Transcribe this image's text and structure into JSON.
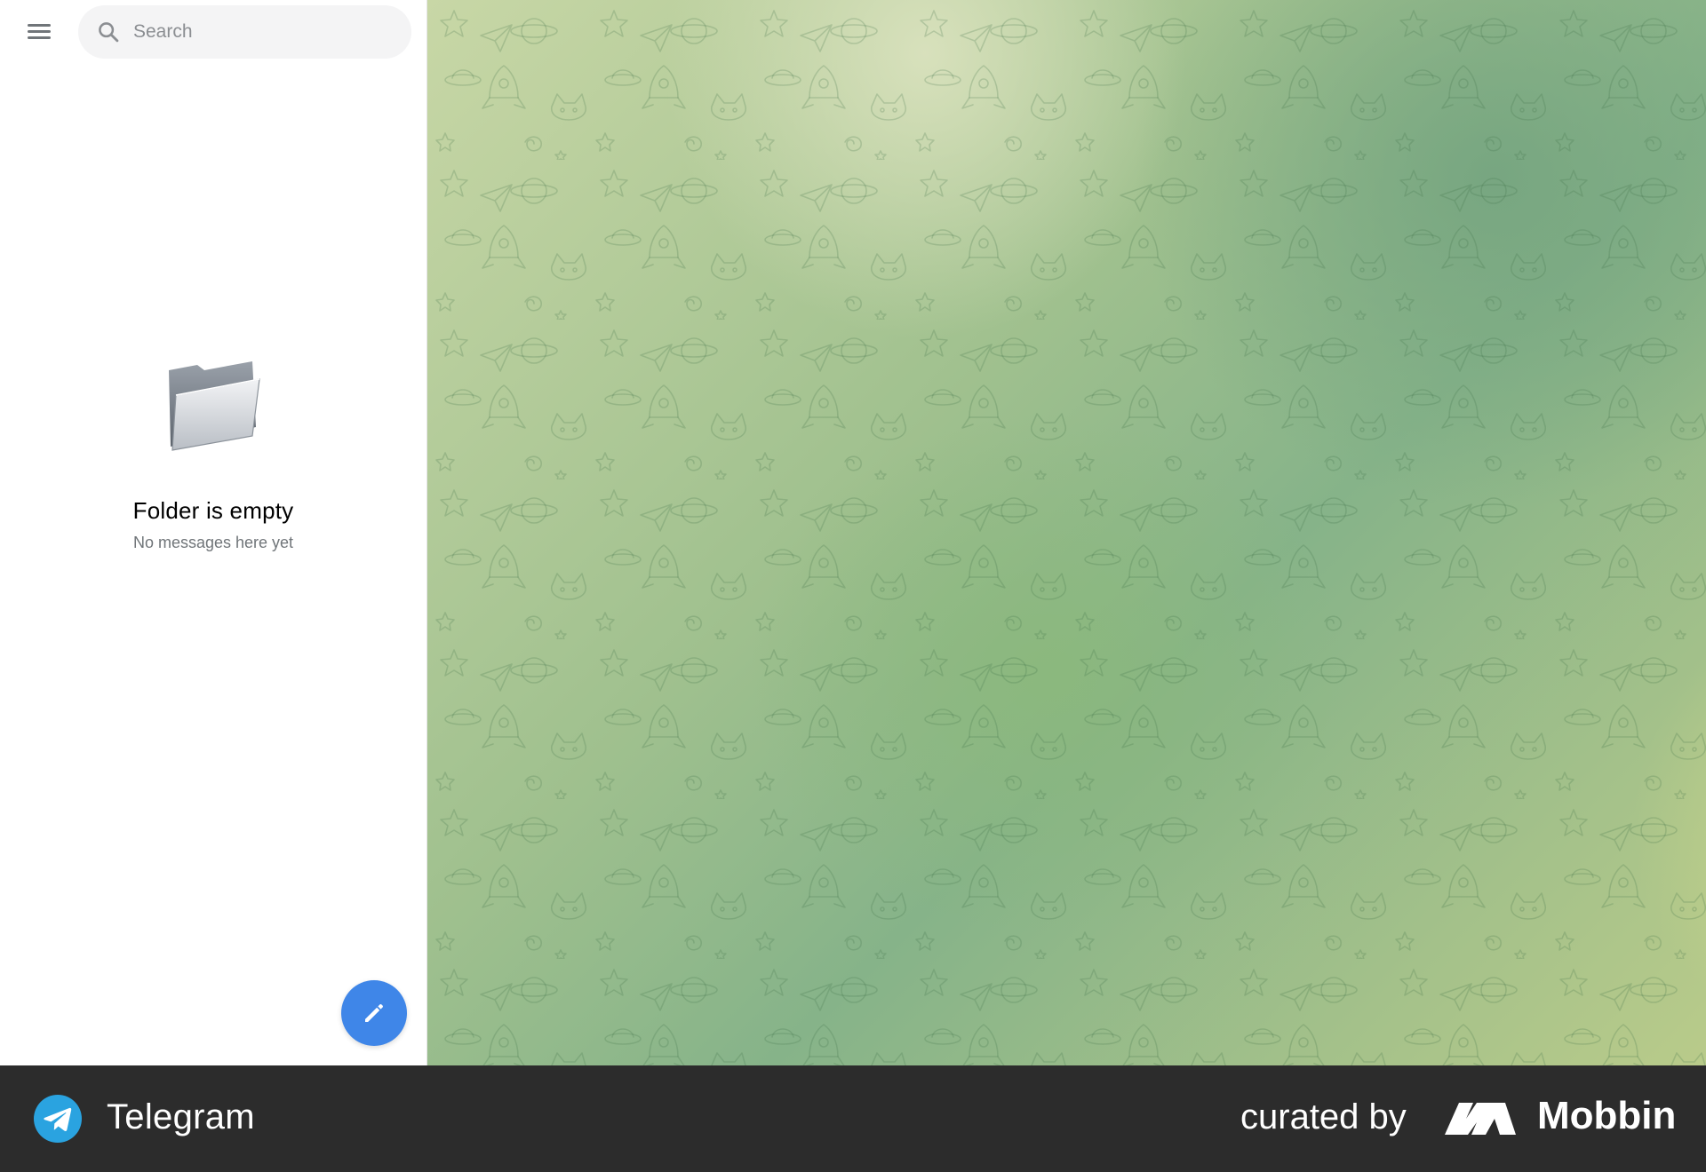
{
  "sidebar": {
    "menu_icon": "hamburger-menu-icon",
    "search": {
      "placeholder": "Search",
      "value": "",
      "icon": "search-icon"
    },
    "empty_state": {
      "icon": "folder-icon",
      "title": "Folder is empty",
      "subtitle": "No messages here yet"
    },
    "compose_button": {
      "icon": "pencil-icon",
      "color": "#3f86e8"
    }
  },
  "footer": {
    "app_icon": "telegram-logo-icon",
    "app_name": "Telegram",
    "curated_label": "curated by",
    "brand_mark": "mobbin-logo-icon",
    "brand_name": "Mobbin"
  }
}
